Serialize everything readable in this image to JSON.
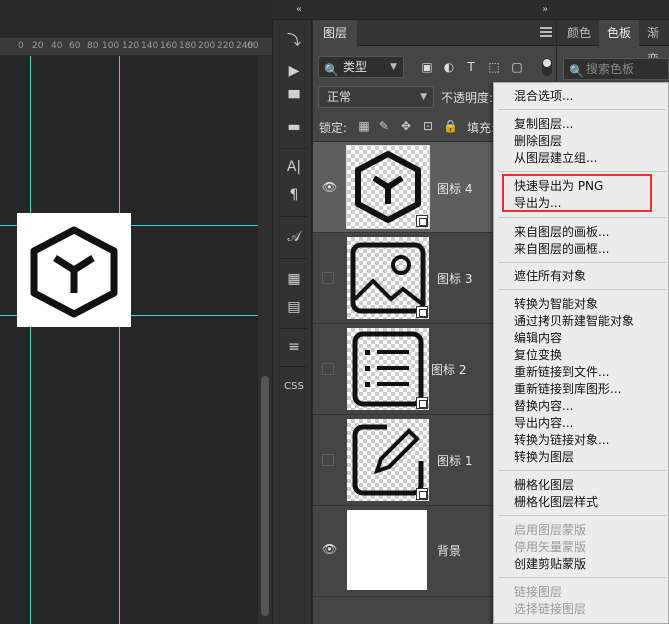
{
  "canvas": {
    "ruler_labels": [
      "0",
      "20",
      "40",
      "60",
      "80",
      "100",
      "120",
      "140",
      "160",
      "180",
      "200",
      "220",
      "240",
      "26",
      "60"
    ]
  },
  "collapse": {
    "left": "«",
    "right": "»"
  },
  "tools": [
    {
      "icon": "history-icon",
      "glyph": "⤵"
    },
    {
      "icon": "play-icon",
      "glyph": "▶"
    },
    {
      "icon": "brush-presets-icon",
      "glyph": "▀"
    },
    {
      "icon": "comment-icon",
      "glyph": "▬"
    },
    {
      "icon": "character-icon",
      "glyph": "A|"
    },
    {
      "icon": "paragraph-icon",
      "glyph": "¶"
    },
    {
      "icon": "glyph-icon",
      "glyph": "𝒜"
    },
    {
      "icon": "artboard-icon",
      "glyph": "▦"
    },
    {
      "icon": "notes-icon",
      "glyph": "▤"
    },
    {
      "icon": "adjust-icon",
      "glyph": "≡"
    },
    {
      "icon": "css-icon",
      "glyph": "CSS"
    }
  ],
  "layers_panel": {
    "tab_label": "图层",
    "filter_value": "类型",
    "blend_mode": "正常",
    "opacity_label": "不透明度:",
    "lock_label": "锁定:",
    "fill_label": "填充:",
    "layers": [
      {
        "name": "图标 4",
        "visible": true,
        "selected": true,
        "thumb": "box"
      },
      {
        "name": "图标 3",
        "visible": false,
        "selected": false,
        "thumb": "image"
      },
      {
        "name": "图标 2",
        "visible": false,
        "selected": false,
        "thumb": "list"
      },
      {
        "name": "图标 1",
        "visible": false,
        "selected": false,
        "thumb": "edit"
      },
      {
        "name": "背景",
        "visible": true,
        "selected": false,
        "thumb": "plain"
      }
    ]
  },
  "right_panel": {
    "tabs": [
      "颜色",
      "色板",
      "渐变"
    ],
    "search_placeholder": "搜索色板"
  },
  "context_menu": {
    "items": [
      {
        "label": "混合选项...",
        "enabled": true
      },
      {
        "label": "复制图层...",
        "enabled": true
      },
      {
        "label": "删除图层",
        "enabled": true
      },
      {
        "label": "从图层建立组...",
        "enabled": true
      },
      {
        "label": "快速导出为 PNG",
        "enabled": true
      },
      {
        "label": "导出为...",
        "enabled": true
      },
      {
        "label": "来自图层的画板...",
        "enabled": true
      },
      {
        "label": "来自图层的画框...",
        "enabled": true
      },
      {
        "label": "遮住所有对象",
        "enabled": true
      },
      {
        "label": "转换为智能对象",
        "enabled": true
      },
      {
        "label": "通过拷贝新建智能对象",
        "enabled": true
      },
      {
        "label": "编辑内容",
        "enabled": true
      },
      {
        "label": "复位变换",
        "enabled": true
      },
      {
        "label": "重新链接到文件...",
        "enabled": true
      },
      {
        "label": "重新链接到库图形...",
        "enabled": true
      },
      {
        "label": "替换内容...",
        "enabled": true
      },
      {
        "label": "导出内容...",
        "enabled": true
      },
      {
        "label": "转换为链接对象...",
        "enabled": true
      },
      {
        "label": "转换为图层",
        "enabled": true
      },
      {
        "label": "栅格化图层",
        "enabled": true
      },
      {
        "label": "栅格化图层样式",
        "enabled": true
      },
      {
        "label": "启用图层蒙版",
        "enabled": false
      },
      {
        "label": "停用矢量蒙版",
        "enabled": false
      },
      {
        "label": "创建剪贴蒙版",
        "enabled": true
      },
      {
        "label": "链接图层",
        "enabled": false
      },
      {
        "label": "选择链接图层",
        "enabled": false
      }
    ],
    "highlight_color": "#e53333"
  }
}
